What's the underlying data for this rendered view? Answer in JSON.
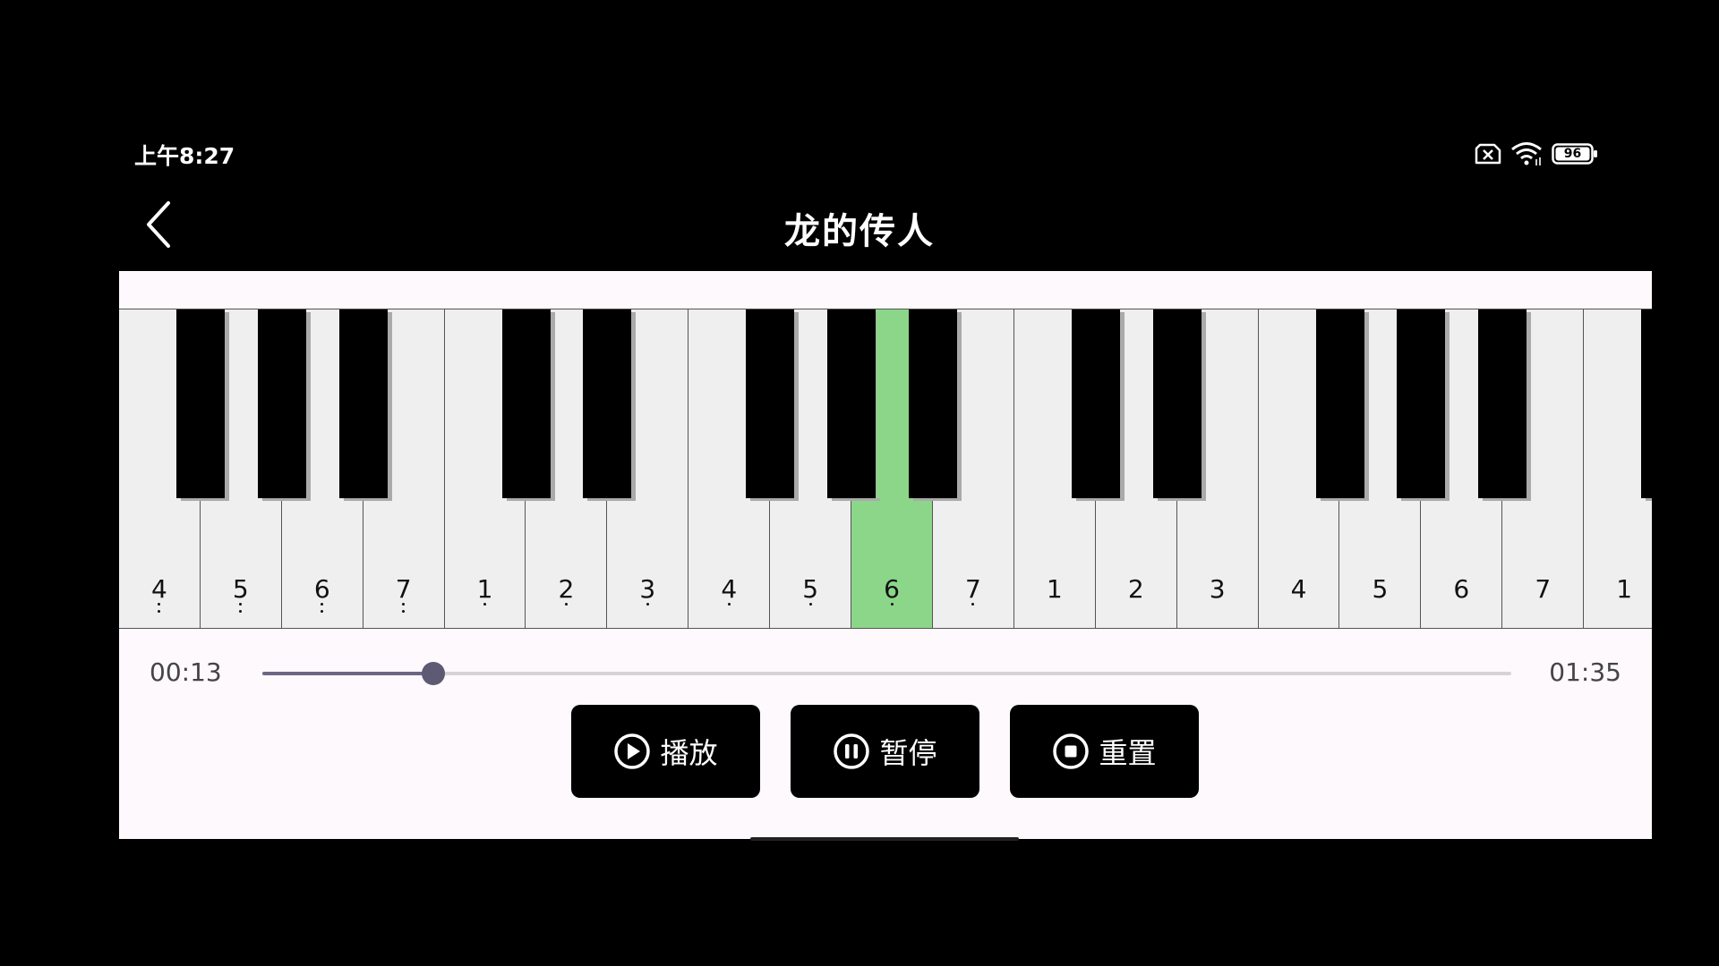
{
  "status_bar": {
    "time": "上午8:27",
    "battery": "96",
    "icons": [
      "sim-off-icon",
      "wifi-icon",
      "battery-icon"
    ]
  },
  "header": {
    "title": "龙的传人",
    "back_icon": "chevron-left-icon"
  },
  "piano": {
    "keys": [
      {
        "label": "4",
        "dots": 2
      },
      {
        "label": "5",
        "dots": 2
      },
      {
        "label": "6",
        "dots": 2
      },
      {
        "label": "7",
        "dots": 2
      },
      {
        "label": "1",
        "dots": 1
      },
      {
        "label": "2",
        "dots": 1
      },
      {
        "label": "3",
        "dots": 1
      },
      {
        "label": "4",
        "dots": 1
      },
      {
        "label": "5",
        "dots": 1
      },
      {
        "label": "6",
        "dots": 1,
        "active": true
      },
      {
        "label": "7",
        "dots": 1
      },
      {
        "label": "1",
        "dots": 0
      },
      {
        "label": "2",
        "dots": 0
      },
      {
        "label": "3",
        "dots": 0
      },
      {
        "label": "4",
        "dots": 0
      },
      {
        "label": "5",
        "dots": 0
      },
      {
        "label": "6",
        "dots": 0
      },
      {
        "label": "7",
        "dots": 0
      },
      {
        "label": "1",
        "dots": 0
      }
    ],
    "active_color": "#8cd68a"
  },
  "player": {
    "current_time": "00:13",
    "total_time": "01:35",
    "progress": 0.137,
    "accent": "#5e5a73"
  },
  "controls": {
    "play_label": "播放",
    "pause_label": "暂停",
    "reset_label": "重置",
    "play_icon": "play-circle-icon",
    "pause_icon": "pause-circle-icon",
    "reset_icon": "stop-circle-icon"
  }
}
